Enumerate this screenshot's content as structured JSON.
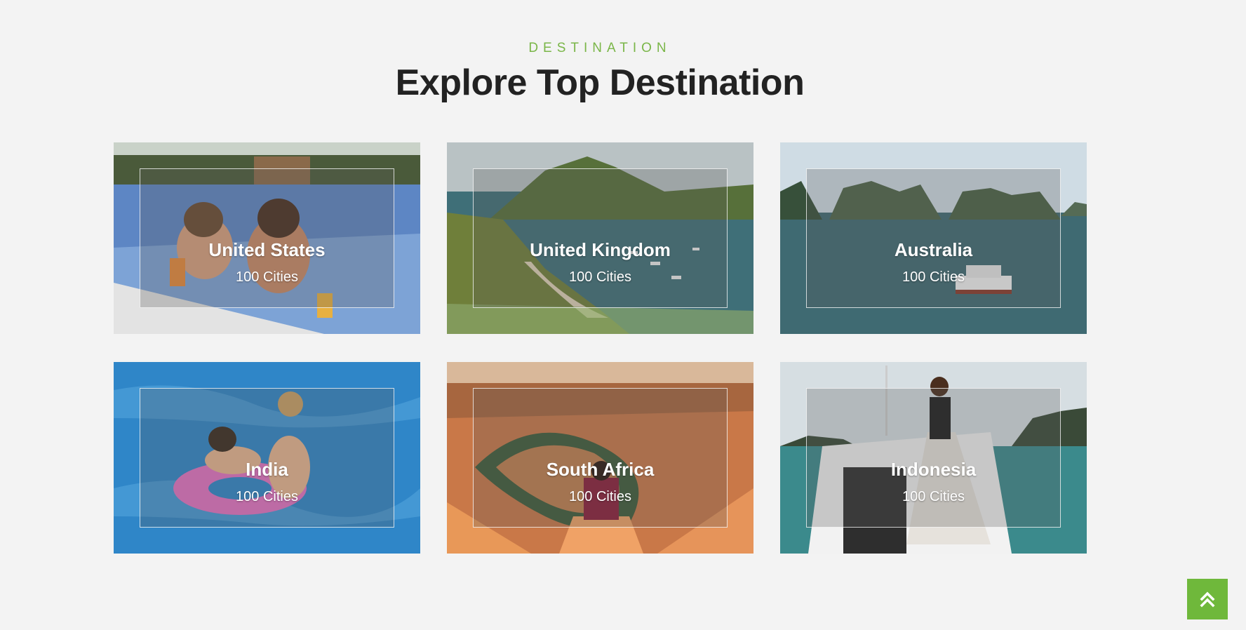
{
  "section": {
    "eyebrow": "DESTINATION",
    "title": "Explore Top Destination"
  },
  "destinations": [
    {
      "name": "United States",
      "cities": "100 Cities",
      "photo": "pool-girls"
    },
    {
      "name": "United Kingdom",
      "cities": "100 Cities",
      "photo": "coastal-mountains"
    },
    {
      "name": "Australia",
      "cities": "100 Cities",
      "photo": "bay-islands"
    },
    {
      "name": "India",
      "cities": "100 Cities",
      "photo": "pool-float"
    },
    {
      "name": "South Africa",
      "cities": "100 Cities",
      "photo": "canyon-bend"
    },
    {
      "name": "Indonesia",
      "cities": "100 Cities",
      "photo": "boat-woman"
    }
  ],
  "scroll_top": {
    "icon": "double-chevron-up-icon"
  },
  "colors": {
    "accent": "#7ab648",
    "heading": "#222222",
    "background": "#f3f3f3",
    "button": "#6fb83b"
  }
}
